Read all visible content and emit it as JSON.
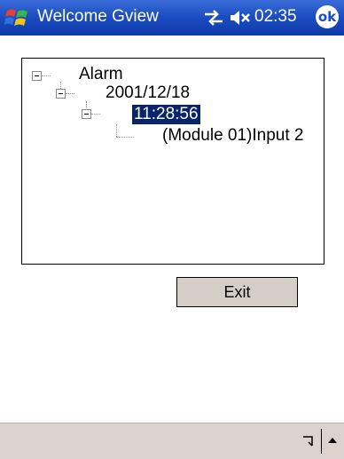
{
  "titlebar": {
    "title": "Welcome Gview",
    "clock": "02:35",
    "ok_label": "ok"
  },
  "tree": {
    "root_label": "Alarm",
    "date_label": "2001/12/18",
    "time_label": "11:28:56",
    "leaf_label": "(Module 01)Input 2"
  },
  "exit_label": "Exit",
  "colors": {
    "titlebar": "#1a4cc0",
    "selection": "#0a246a",
    "button_face": "#d6cfc8",
    "bottombar": "#dbd3cc"
  }
}
